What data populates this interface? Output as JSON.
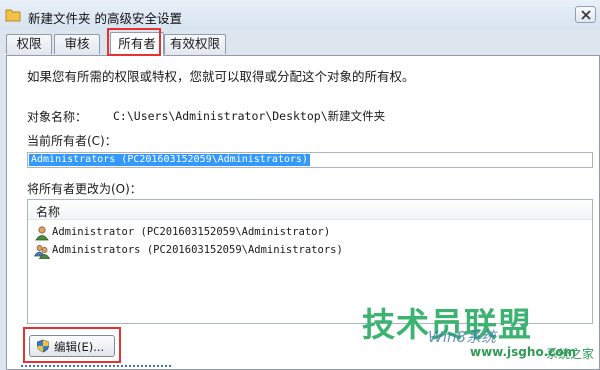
{
  "window": {
    "title": "新建文件夹 的高级安全设置",
    "close_icon": "close-icon"
  },
  "tabs": [
    {
      "label": "权限",
      "active": false
    },
    {
      "label": "审核",
      "active": false
    },
    {
      "label": "所有者",
      "active": true
    },
    {
      "label": "有效权限",
      "active": false
    }
  ],
  "owner_tab": {
    "intro": "如果您有所需的权限或特权，您就可以取得或分配这个对象的所有权。",
    "object_name_label": "对象名称：",
    "object_name_value": "C:\\Users\\Administrator\\Desktop\\新建文件夹",
    "current_owner_label": "当前所有者(C)：",
    "current_owner_value": "Administrators (PC201603152059\\Administrators)",
    "change_owner_label": "将所有者更改为(O)：",
    "list": {
      "column_header": "名称",
      "items": [
        {
          "name": "Administrator (PC201603152059\\Administrator)",
          "icon": "user-icon"
        },
        {
          "name": "Administrators (PC201603152059\\Administrators)",
          "icon": "group-icon"
        }
      ]
    },
    "edit_button_label": "编辑(E)..."
  },
  "watermark": {
    "brand": "技术员联盟",
    "logo_text": "Win8系统",
    "url": "www.jsgho.com",
    "url_suffix": "系统之家"
  },
  "colors": {
    "highlight": "#e53333",
    "selection": "#3399ff"
  }
}
